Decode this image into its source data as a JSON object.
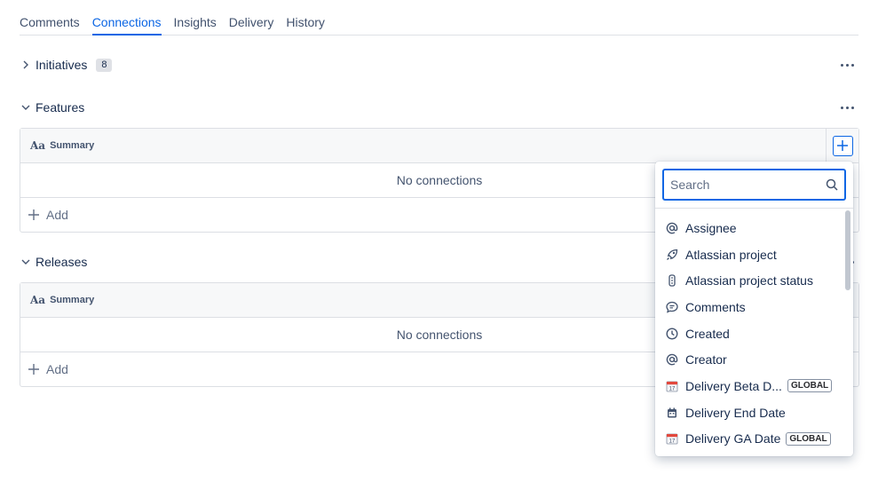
{
  "tabs": [
    {
      "label": "Comments",
      "active": false
    },
    {
      "label": "Connections",
      "active": true
    },
    {
      "label": "Insights",
      "active": false
    },
    {
      "label": "Delivery",
      "active": false
    },
    {
      "label": "History",
      "active": false
    }
  ],
  "sections": {
    "initiatives": {
      "title": "Initiatives",
      "count": "8",
      "expanded": false
    },
    "features": {
      "title": "Features",
      "expanded": true,
      "column_header": "Summary",
      "empty_text": "No connections",
      "add_label": "Add"
    },
    "releases": {
      "title": "Releases",
      "expanded": true,
      "column_header": "Summary",
      "empty_text": "No connections",
      "add_label": "Add"
    }
  },
  "popup": {
    "search_placeholder": "Search",
    "items": [
      {
        "label": "Assignee",
        "icon": "at-icon"
      },
      {
        "label": "Atlassian project",
        "icon": "rocket-icon"
      },
      {
        "label": "Atlassian project status",
        "icon": "traffic-light-icon"
      },
      {
        "label": "Comments",
        "icon": "comment-icon"
      },
      {
        "label": "Created",
        "icon": "clock-icon"
      },
      {
        "label": "Creator",
        "icon": "at-icon"
      },
      {
        "label": "Delivery Beta D...",
        "icon": "calendar-emoji-icon",
        "badge": "GLOBAL"
      },
      {
        "label": "Delivery End Date",
        "icon": "calendar-icon"
      },
      {
        "label": "Delivery GA Date",
        "icon": "calendar-emoji-icon",
        "badge": "GLOBAL"
      }
    ]
  },
  "colors": {
    "accent": "#0c66e4",
    "text": "#172b4d",
    "subtle": "#44546f",
    "border": "#dcdfe4"
  }
}
